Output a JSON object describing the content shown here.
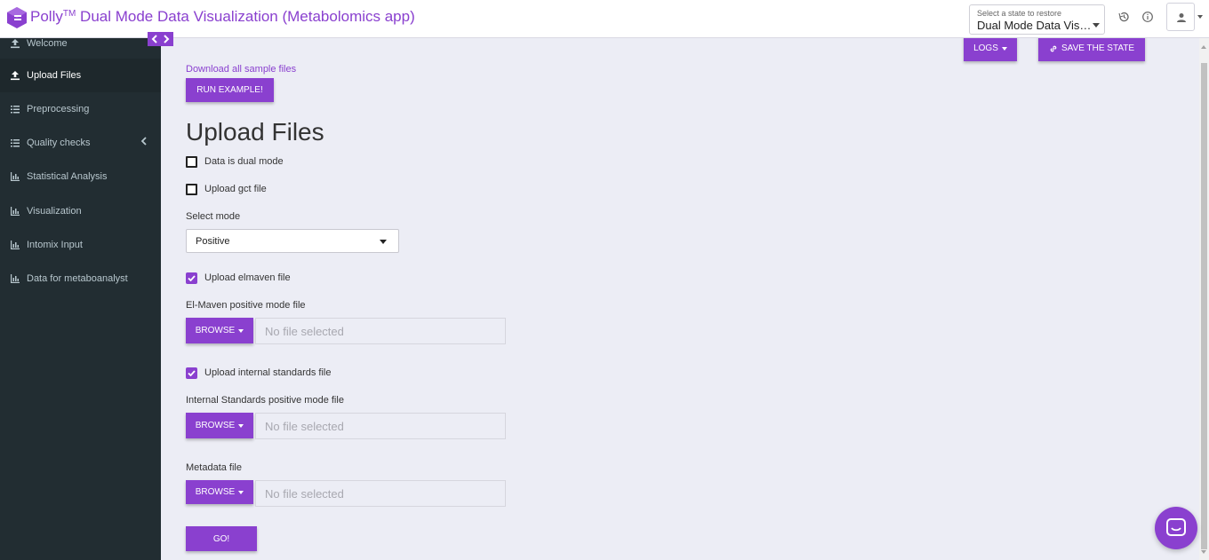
{
  "header": {
    "app_title": "Polly",
    "trademark": "TM",
    "app_subtitle": "Dual Mode Data Visualization (Metabolomics app)",
    "state_select": {
      "label": "Select a state to restore",
      "value": "Dual Mode Data Visu..."
    }
  },
  "sidebar": {
    "items": [
      {
        "label": "Welcome",
        "icon": "upload-icon"
      },
      {
        "label": "Upload Files",
        "icon": "upload-icon",
        "active": true
      },
      {
        "label": "Preprocessing",
        "icon": "list-icon"
      },
      {
        "label": "Quality checks",
        "icon": "list-icon",
        "has_children": true
      },
      {
        "label": "Statistical Analysis",
        "icon": "bar-chart-icon"
      },
      {
        "label": "Visualization",
        "icon": "bar-chart-icon"
      },
      {
        "label": "Intomix Input",
        "icon": "bar-chart-icon"
      },
      {
        "label": "Data for metaboanalyst",
        "icon": "bar-chart-icon"
      }
    ]
  },
  "toolbar": {
    "logs_label": "LOGS",
    "save_state_label": "SAVE THE STATE"
  },
  "main": {
    "download_link": "Download all sample files",
    "run_example_label": "RUN EXAMPLE!",
    "page_title": "Upload Files",
    "dual_mode": {
      "label": "Data is dual mode",
      "checked": false
    },
    "gct_file": {
      "label": "Upload gct file",
      "checked": false
    },
    "select_mode": {
      "label": "Select mode",
      "value": "Positive"
    },
    "elmaven": {
      "label": "Upload elmaven file",
      "checked": true
    },
    "elmaven_file": {
      "label": "El-Maven positive mode file",
      "browse_label": "BROWSE",
      "placeholder": "No file selected"
    },
    "internal_standards": {
      "label": "Upload internal standards file",
      "checked": true
    },
    "internal_file": {
      "label": "Internal Standards positive mode file",
      "browse_label": "BROWSE",
      "placeholder": "No file selected"
    },
    "metadata_file": {
      "label": "Metadata file",
      "browse_label": "BROWSE",
      "placeholder": "No file selected"
    },
    "go_label": "GO!"
  },
  "colors": {
    "accent": "#8a40cf",
    "sidebar_bg": "#222d32",
    "content_bg": "#ecedf5"
  }
}
